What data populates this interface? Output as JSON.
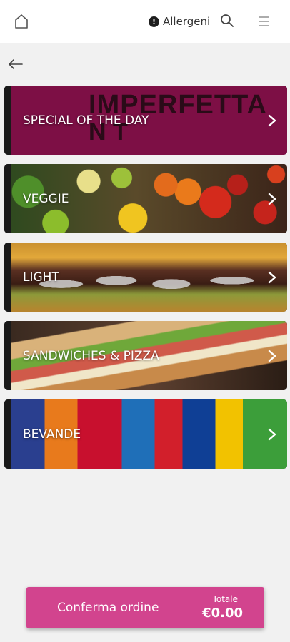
{
  "header": {
    "allergen_label": "Allergeni",
    "allergen_mark": "!",
    "icons": [
      "home-icon",
      "info-icon",
      "search-icon",
      "menu-icon"
    ]
  },
  "nav": {
    "back_icon": "arrow-left-icon"
  },
  "categories": [
    {
      "label": "SPECIAL OF THE DAY",
      "image": "imperfetta-logo-banner",
      "logo_text": "IMPERFETTA",
      "logo_sub": "N T"
    },
    {
      "label": "VEGGIE",
      "image": "vegetables-photo"
    },
    {
      "label": "LIGHT",
      "image": "burger-photo"
    },
    {
      "label": "SANDWICHES & PIZZA",
      "image": "sandwich-photo"
    },
    {
      "label": "BEVANDE",
      "image": "soft-drinks-photo"
    }
  ],
  "footer": {
    "confirm_label": "Conferma ordine",
    "total_label": "Totale",
    "total_amount": "€0.00"
  },
  "colors": {
    "accent": "#d2448e",
    "special_banner": "#7d0f45",
    "header_bg": "#ffffff",
    "page_bg": "#f1f1f1"
  }
}
